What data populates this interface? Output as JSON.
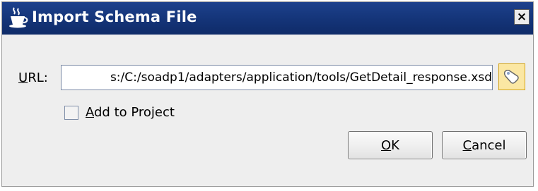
{
  "window": {
    "title": "Import Schema File",
    "close_symbol": "×",
    "title_icon": "coffee-cup-icon"
  },
  "form": {
    "url_label_mnemonic": "U",
    "url_label_rest": "RL:",
    "url_value": "s:/C:/soadp1/adapters/application/tools/GetDetail_response.xsd",
    "browse_icon": "browse-icon",
    "add_to_project_mnemonic": "A",
    "add_to_project_rest": "dd to Project",
    "add_to_project_checked": false
  },
  "buttons": {
    "ok_mnemonic": "O",
    "ok_rest": "K",
    "cancel_mnemonic": "C",
    "cancel_rest": "ancel"
  },
  "colors": {
    "titlebar": "#143478",
    "dialog_background": "#eeeeee",
    "browse_button": "#fbe7a3"
  }
}
